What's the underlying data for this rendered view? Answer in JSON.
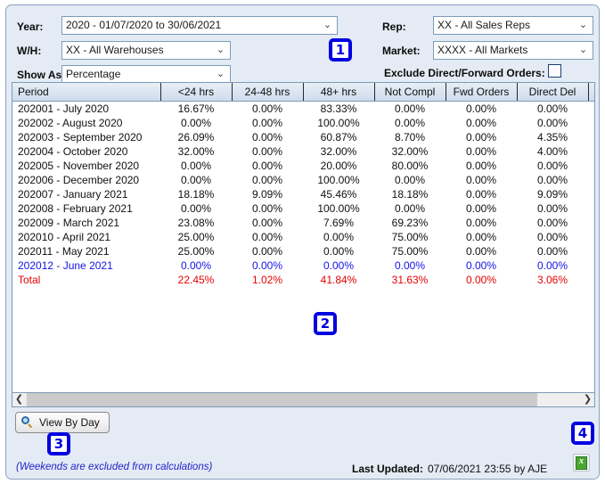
{
  "filters": {
    "year_label": "Year:",
    "year_value": "2020 - 01/07/2020 to 30/06/2021",
    "wh_label": "W/H:",
    "wh_value": "XX - All Warehouses",
    "showas_label": "Show As:",
    "showas_value": "Percentage",
    "rep_label": "Rep:",
    "rep_value": "XX - All Sales Reps",
    "market_label": "Market:",
    "market_value": "XXXX - All Markets",
    "exclude_label": "Exclude Direct/Forward Orders:",
    "chevron_icon": "chevron-down-icon"
  },
  "badges": {
    "one": "1",
    "two": "2",
    "three": "3",
    "four": "4"
  },
  "grid": {
    "headers": [
      "Period",
      "<24 hrs",
      "24-48 hrs",
      "48+ hrs",
      "Not Compl",
      "Fwd Orders",
      "Direct Del",
      ""
    ],
    "rows": [
      {
        "style": "normal",
        "cells": [
          "202001 - July 2020",
          "16.67%",
          "0.00%",
          "83.33%",
          "0.00%",
          "0.00%",
          "0.00%",
          ""
        ]
      },
      {
        "style": "normal",
        "cells": [
          "202002 - August 2020",
          "0.00%",
          "0.00%",
          "100.00%",
          "0.00%",
          "0.00%",
          "0.00%",
          ""
        ]
      },
      {
        "style": "normal",
        "cells": [
          "202003 - September 2020",
          "26.09%",
          "0.00%",
          "60.87%",
          "8.70%",
          "0.00%",
          "4.35%",
          ""
        ]
      },
      {
        "style": "normal",
        "cells": [
          "202004 - October 2020",
          "32.00%",
          "0.00%",
          "32.00%",
          "32.00%",
          "0.00%",
          "4.00%",
          ""
        ]
      },
      {
        "style": "normal",
        "cells": [
          "202005 - November 2020",
          "0.00%",
          "0.00%",
          "20.00%",
          "80.00%",
          "0.00%",
          "0.00%",
          ""
        ]
      },
      {
        "style": "normal",
        "cells": [
          "202006 - December 2020",
          "0.00%",
          "0.00%",
          "100.00%",
          "0.00%",
          "0.00%",
          "0.00%",
          ""
        ]
      },
      {
        "style": "normal",
        "cells": [
          "202007 - January 2021",
          "18.18%",
          "9.09%",
          "45.46%",
          "18.18%",
          "0.00%",
          "9.09%",
          ""
        ]
      },
      {
        "style": "normal",
        "cells": [
          "202008 - February 2021",
          "0.00%",
          "0.00%",
          "100.00%",
          "0.00%",
          "0.00%",
          "0.00%",
          ""
        ]
      },
      {
        "style": "normal",
        "cells": [
          "202009 - March 2021",
          "23.08%",
          "0.00%",
          "7.69%",
          "69.23%",
          "0.00%",
          "0.00%",
          ""
        ]
      },
      {
        "style": "normal",
        "cells": [
          "202010 - April 2021",
          "25.00%",
          "0.00%",
          "0.00%",
          "75.00%",
          "0.00%",
          "0.00%",
          ""
        ]
      },
      {
        "style": "normal",
        "cells": [
          "202011 - May 2021",
          "25.00%",
          "0.00%",
          "0.00%",
          "75.00%",
          "0.00%",
          "0.00%",
          ""
        ]
      },
      {
        "style": "blue",
        "cells": [
          "202012 - June 2021",
          "0.00%",
          "0.00%",
          "0.00%",
          "0.00%",
          "0.00%",
          "0.00%",
          ""
        ]
      },
      {
        "style": "red",
        "cells": [
          "Total",
          "22.45%",
          "1.02%",
          "41.84%",
          "31.63%",
          "0.00%",
          "3.06%",
          ""
        ]
      }
    ]
  },
  "scrollbar": {
    "left_arrow_icon": "chevron-left-icon",
    "right_arrow_icon": "chevron-right-icon"
  },
  "actions": {
    "view_by_day_label": "View By Day",
    "view_by_day_icon": "magnifier-icon",
    "export_icon": "excel-export-icon"
  },
  "footer": {
    "note": "(Weekends are excluded from calculations)",
    "last_updated_label": "Last Updated:",
    "last_updated_value": "07/06/2021 23:55 by AJE"
  }
}
